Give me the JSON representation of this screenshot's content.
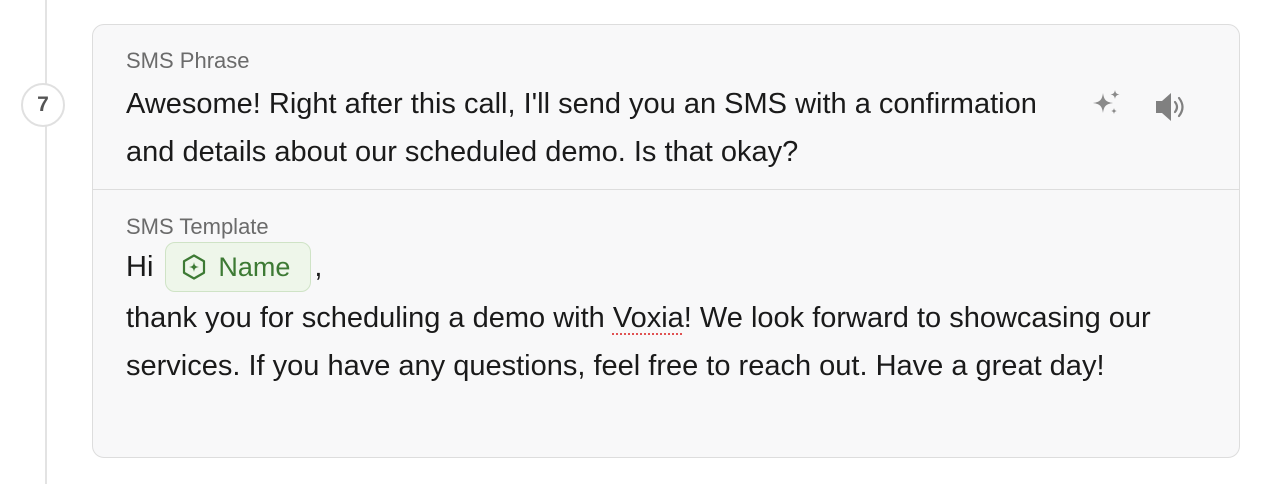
{
  "step": {
    "number": "7"
  },
  "sms_phrase": {
    "label": "SMS Phrase",
    "text": "Awesome! Right after this call, I'll send you an SMS with a confirmation and details about our scheduled demo. Is that okay?",
    "actions": [
      {
        "icon": "sparkles-icon"
      },
      {
        "icon": "speaker-icon"
      }
    ]
  },
  "sms_template": {
    "label": "SMS Template",
    "greeting": "Hi",
    "variable": {
      "label": "Name",
      "icon": "variable-hexagon-icon"
    },
    "comma": ",",
    "body_before": "thank you for scheduling a demo with ",
    "flagged_word": "Voxia",
    "body_after": "! We look forward to showcasing our services. If you have any questions, feel free to reach out. Have a great day!"
  },
  "colors": {
    "chip_bg": "#eef6ea",
    "chip_text": "#3d7a34",
    "card_bg": "#f8f8f9",
    "border": "#dddddd",
    "spellcheck": "#e05252"
  }
}
